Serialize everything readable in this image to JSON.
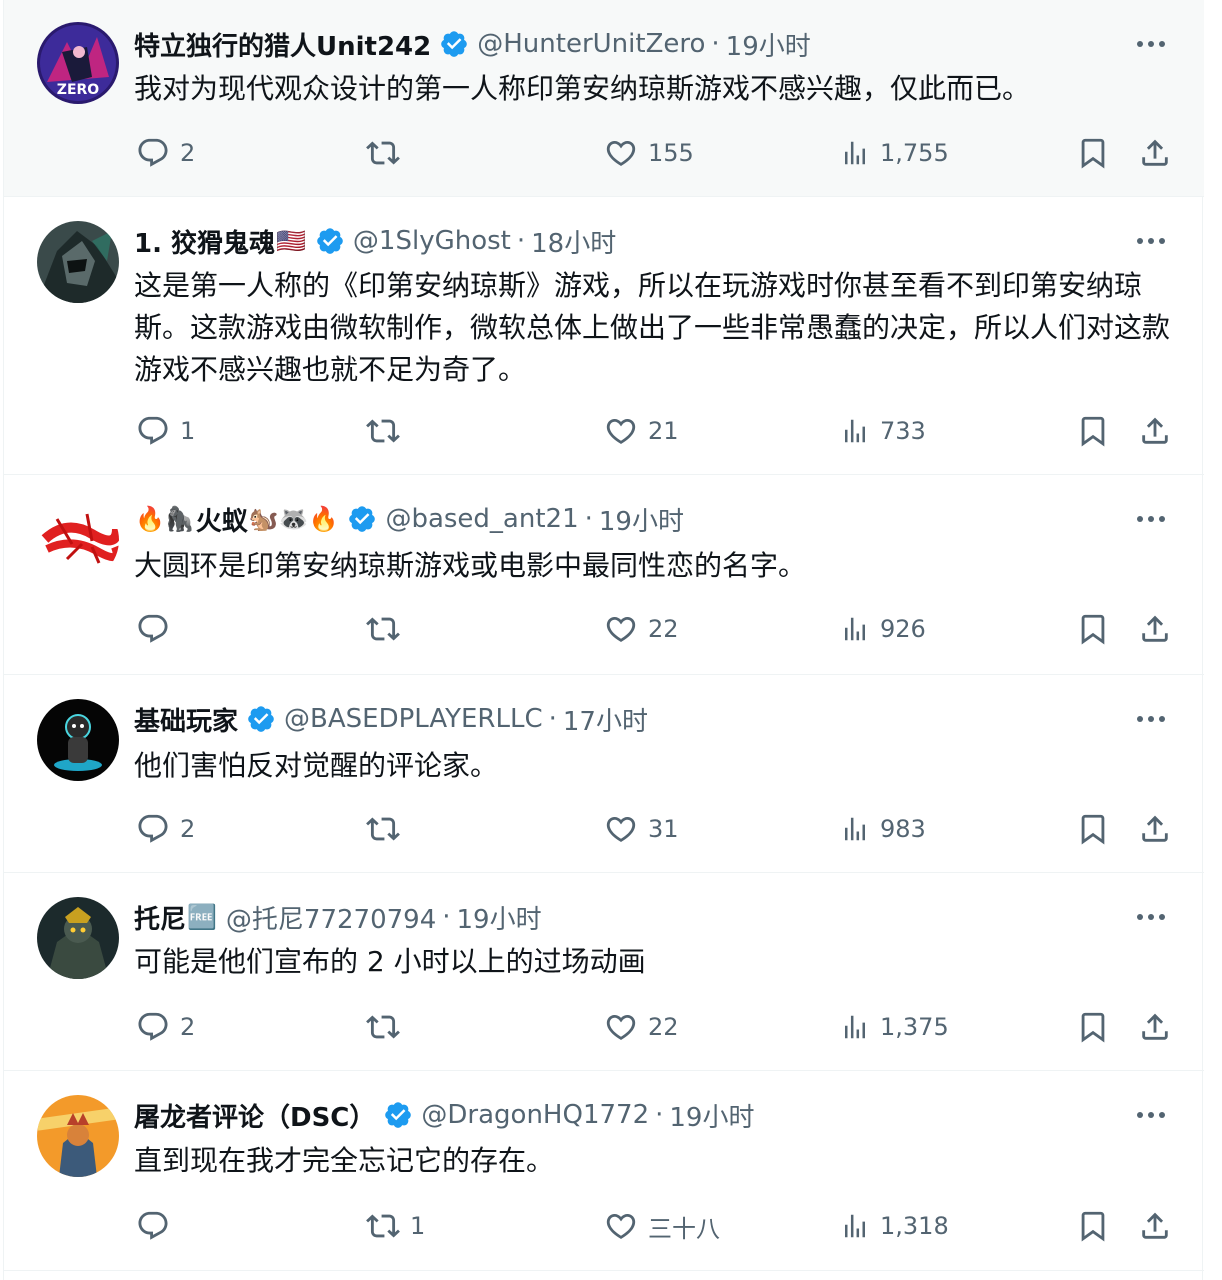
{
  "tweets": [
    {
      "name": "特立独行的猎人Unit242",
      "emoji": "",
      "handle": "@HunterUnitZero",
      "time": "19小时",
      "text": "我对为现代观众设计的第一人称印第安纳琼斯游戏不感兴趣，仅此而已。",
      "replies": "2",
      "reposts": "",
      "likes": "155",
      "views": "1,755",
      "avatar": "avatar-zero",
      "highlighted": true
    },
    {
      "name": "1. 狡猾鬼魂",
      "emoji": "🇺🇸",
      "handle": "@1SlyGhost",
      "time": "18小时",
      "text": "这是第一人称的《印第安纳琼斯》游戏，所以在玩游戏时你甚至看不到印第安纳琼斯。这款游戏由微软制作，微软总体上做出了一些非常愚蠢的决定，所以人们对这款游戏不感兴趣也就不足为奇了。",
      "replies": "1",
      "reposts": "",
      "likes": "21",
      "views": "733",
      "avatar": "avatar-ghost",
      "highlighted": false
    },
    {
      "name": "火蚁",
      "emoji_before": "🔥🦍",
      "emoji": "🐿️🦝🔥",
      "handle": "@based_ant21",
      "time": "19小时",
      "text": "大圆环是印第安纳琼斯游戏或电影中最同性恋的名字。",
      "replies": "",
      "reposts": "",
      "likes": "22",
      "views": "926",
      "avatar": "avatar-ant",
      "highlighted": false
    },
    {
      "name": "基础玩家",
      "emoji": "",
      "handle": "@BASEDPLAYERLLC",
      "time": "17小时",
      "text": "他们害怕反对觉醒的评论家。",
      "replies": "2",
      "reposts": "",
      "likes": "31",
      "views": "983",
      "avatar": "avatar-player",
      "highlighted": false
    },
    {
      "name": "托尼",
      "emoji": "🆓",
      "handle": "@托尼77270794",
      "time": "19小时",
      "text": "可能是他们宣布的 2 小时以上的过场动画",
      "replies": "2",
      "reposts": "",
      "likes": "22",
      "views": "1,375",
      "avatar": "avatar-tony",
      "highlighted": false
    },
    {
      "name": "屠龙者评论（DSC）",
      "emoji": "",
      "handle": "@DragonHQ1772",
      "time": "19小时",
      "text": "直到现在我才完全忘记它的存在。",
      "replies": "",
      "reposts": "1",
      "likes": "三十八",
      "views": "1,318",
      "avatar": "avatar-dragon",
      "highlighted": false
    }
  ],
  "colors": {
    "verified": "#1d9bf0",
    "text": "#0f1419",
    "muted": "#536471",
    "divider": "#eff3f4",
    "highlight_bg": "#f7f9f9"
  }
}
